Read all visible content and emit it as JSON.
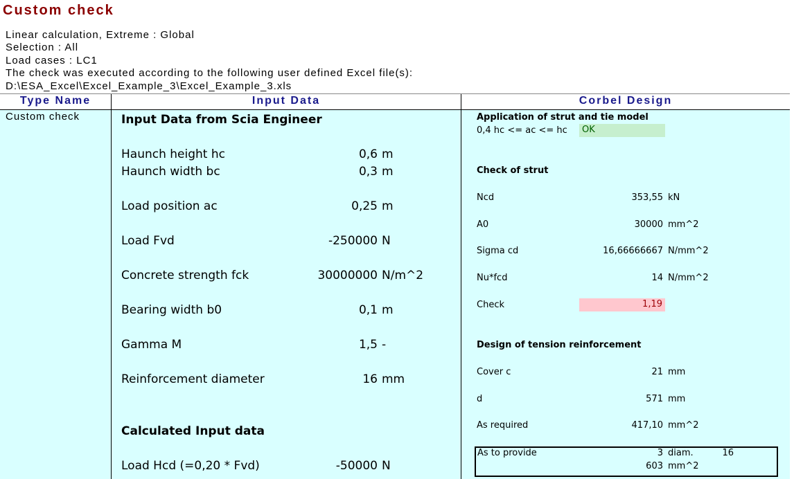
{
  "report": {
    "title": "Custom check",
    "info_lines": [
      "Linear calculation, Extreme : Global",
      "Selection : All",
      "Load cases : LC1",
      "The  check was  executed according to the  following user defined Excel file(s):",
      "D:\\ESA_Excel\\Excel_Example_3\\Excel_Example_3.xls"
    ]
  },
  "table": {
    "headers": [
      "Type Name",
      "Input Data",
      "Corbel Design"
    ],
    "type_name": "Custom check"
  },
  "input_data": {
    "section1_title": "Input Data from Scia Engineer",
    "rows": [
      {
        "label": "Haunch height hc",
        "value": "0,6",
        "unit": "m"
      },
      {
        "label": "Haunch width bc",
        "value": "0,3",
        "unit": "m"
      },
      {
        "label": "Load position ac",
        "value": "0,25",
        "unit": "m"
      },
      {
        "label": "Load Fvd",
        "value": "-250000",
        "unit": "N"
      },
      {
        "label": "Concrete strength fck",
        "value": "30000000",
        "unit": "N/m^2"
      },
      {
        "label": "Bearing width b0",
        "value": "0,1",
        "unit": "m"
      },
      {
        "label": "Gamma M",
        "value": "1,5",
        "unit": "-"
      },
      {
        "label": "Reinforcement diameter",
        "value": "16",
        "unit": "mm"
      }
    ],
    "section2_title": "Calculated Input data",
    "calc_rows": [
      {
        "label": "Load Hcd (=0,20 * Fvd)",
        "value": "-50000",
        "unit": "N"
      }
    ]
  },
  "corbel": {
    "strut_tie_title": "Application of strut and tie model",
    "strut_tie_label": "0,4 hc <= ac <= hc",
    "strut_tie_status": "OK",
    "strut_title": "Check of strut",
    "strut_rows": [
      {
        "label": "Ncd",
        "value": "353,55",
        "unit": "kN"
      },
      {
        "label": "A0",
        "value": "30000",
        "unit": "mm^2"
      },
      {
        "label": "Sigma cd",
        "value": "16,66666667",
        "unit": "N/mm^2"
      },
      {
        "label": "Nu*fcd",
        "value": "14",
        "unit": "N/mm^2"
      }
    ],
    "check_label": "Check",
    "check_value": "1,19",
    "tension_title": "Design of tension reinforcement",
    "tension_rows": [
      {
        "label": "Cover c",
        "value": "21",
        "unit": "mm"
      },
      {
        "label": "d",
        "value": "571",
        "unit": "mm"
      },
      {
        "label": "As required",
        "value": "417,10",
        "unit": "mm^2"
      }
    ],
    "provide": {
      "label": "As to provide",
      "count": "3",
      "diam_label": "diam.",
      "diam_value": "16",
      "area": "603",
      "area_unit": "mm^2"
    }
  },
  "colors": {
    "title": "#8B0000",
    "header_text": "#1a1a8c",
    "body_bg": "#d9ffff",
    "ok_bg": "#c6efce",
    "fail_bg": "#ffc7ce"
  }
}
